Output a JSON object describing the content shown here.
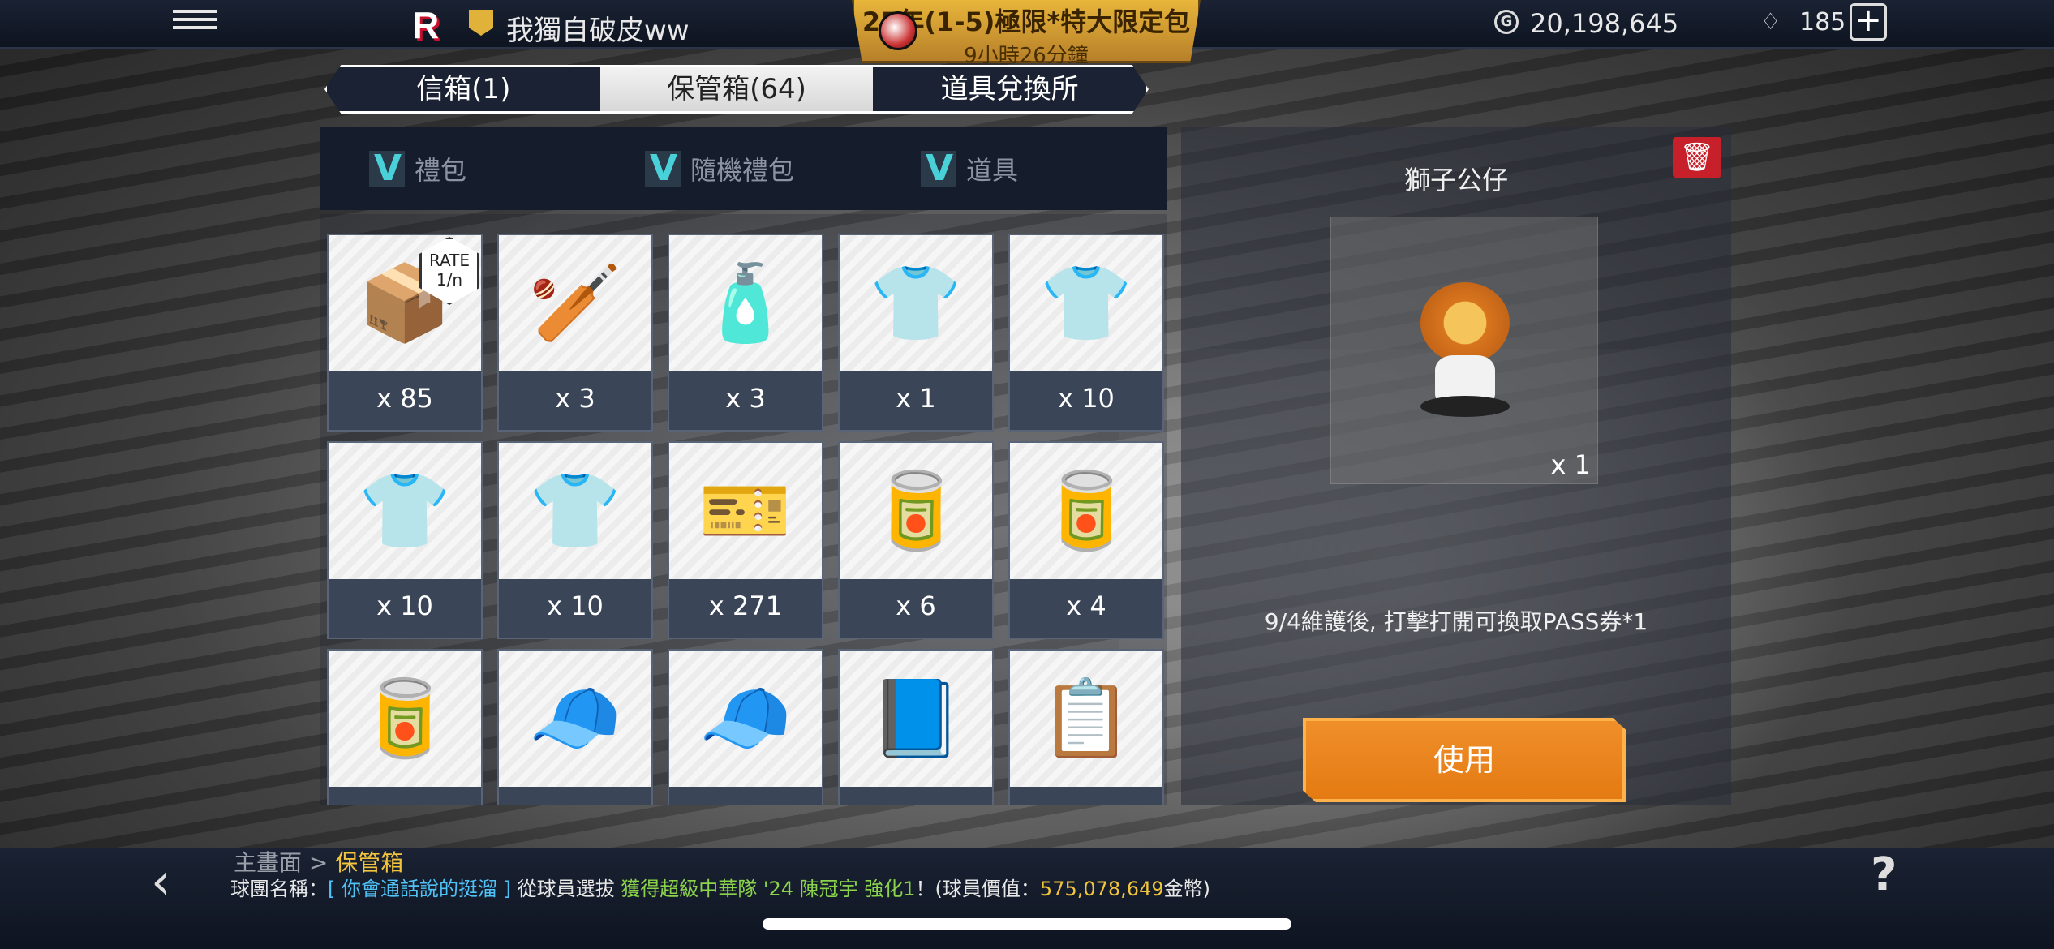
{
  "header": {
    "logo": "R",
    "player_name": "我獨自破皮ww",
    "promo_title": "25年(1-5)極限*特大限定包",
    "promo_timer": "9小時26分鐘",
    "gold_symbol": "G",
    "gold": "20,198,645",
    "gems": "185",
    "plus": "+"
  },
  "tabs": [
    {
      "label": "信箱(1)",
      "active": false
    },
    {
      "label": "保管箱(64)",
      "active": true
    },
    {
      "label": "道具兌換所",
      "active": false
    }
  ],
  "filters": [
    {
      "label": "禮包",
      "checked": true
    },
    {
      "label": "隨機禮包",
      "checked": true
    },
    {
      "label": "道具",
      "checked": true
    }
  ],
  "items": [
    {
      "qty": "x 85",
      "icon": "monthly-pack-icon",
      "art": "📦",
      "rate_label": "RATE",
      "rate_value": "1/n"
    },
    {
      "qty": "x 3",
      "icon": "player-silhouette-icon",
      "art": "🏏"
    },
    {
      "qty": "x 3",
      "icon": "hp-potion-icon",
      "art": "🧴"
    },
    {
      "qty": "x 1",
      "icon": "exp-shirt-icon",
      "art": "👕"
    },
    {
      "qty": "x 10",
      "icon": "exp-shirt-icon",
      "art": "👕"
    },
    {
      "qty": "x 10",
      "icon": "exp-shirt-icon",
      "art": "👕"
    },
    {
      "qty": "x 10",
      "icon": "exp-shirt-icon",
      "art": "👕"
    },
    {
      "qty": "x 271",
      "icon": "pass-ticket-icon",
      "art": "🎫"
    },
    {
      "qty": "x 6",
      "icon": "vital-shake-red-icon",
      "art": "🥫"
    },
    {
      "qty": "x 4",
      "icon": "vital-shake-blue-icon",
      "art": "🥫"
    },
    {
      "qty": "",
      "icon": "vital-shake-brown-icon",
      "art": "🥫"
    },
    {
      "qty": "",
      "icon": "coach-b-icon",
      "art": "🧢"
    },
    {
      "qty": "",
      "icon": "coach-a-icon",
      "art": "🧢"
    },
    {
      "qty": "",
      "icon": "skill-book-icon",
      "art": "📘"
    },
    {
      "qty": "",
      "icon": "order-grade-s-icon",
      "art": "📋"
    }
  ],
  "detail": {
    "trash": "🗑",
    "title": "獅子公仔",
    "qty": "x 1",
    "description": "9/4維護後, 打擊打開可換取PASS券*1",
    "use_label": "使用"
  },
  "footer": {
    "back": "‹",
    "crumb_home": "主畫面",
    "crumb_sep": " > ",
    "crumb_current": "保管箱",
    "ticker_prefix": "球團名稱：",
    "ticker_team": "[ 你會通話說的挺溜 ]",
    "ticker_mid": " 從球員選拔 ",
    "ticker_player": "獲得超級中華隊 '24 陳冠宇 強化1",
    "ticker_after": "！(球員價值：",
    "ticker_value": "575,078,649",
    "ticker_end": "金幣)",
    "help": "?"
  }
}
